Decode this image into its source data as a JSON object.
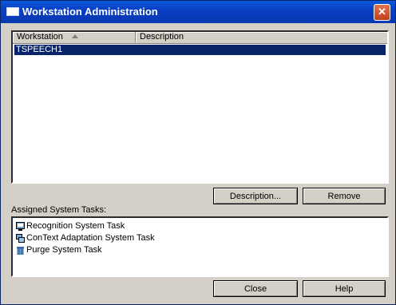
{
  "window": {
    "title": "Workstation Administration",
    "close_glyph": "✕"
  },
  "listview": {
    "columns": [
      "Workstation",
      "Description"
    ],
    "rows": [
      {
        "workstation": "TSPEECH1",
        "description": ""
      }
    ]
  },
  "buttons": {
    "description": "Description...",
    "remove": "Remove",
    "close": "Close",
    "help": "Help"
  },
  "tasks_label": "Assigned System Tasks:",
  "tasks": [
    {
      "label": "Recognition System Task",
      "icon": "recognition-task-icon"
    },
    {
      "label": "ConText Adaptation System Task",
      "icon": "adaptation-task-icon"
    },
    {
      "label": "Purge System Task",
      "icon": "trash-icon"
    }
  ],
  "colors": {
    "title_bar": "#0a3fc4",
    "selection": "#0a246a",
    "dialog_face": "#d4d0c8"
  }
}
